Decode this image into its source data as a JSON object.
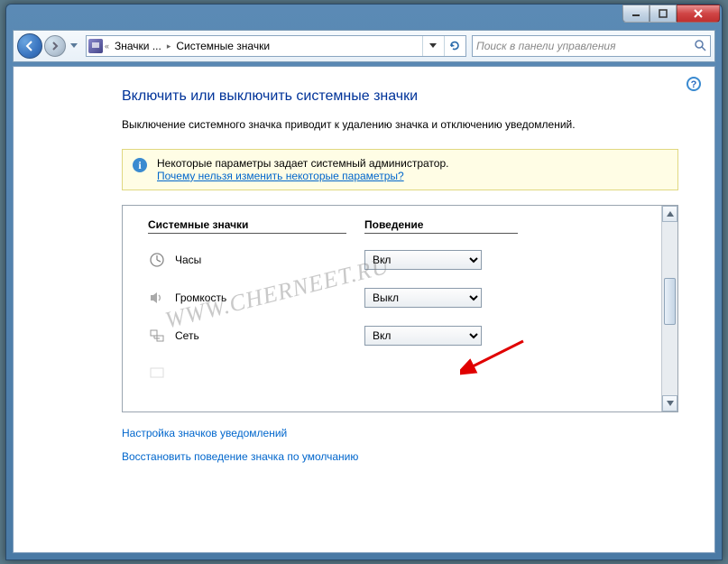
{
  "breadcrumb": {
    "level1": "Значки ...",
    "level2": "Системные значки"
  },
  "search": {
    "placeholder": "Поиск в панели управления"
  },
  "page": {
    "title": "Включить или выключить системные значки",
    "description": "Выключение системного значка приводит к удалению значка и отключению уведомлений."
  },
  "infobar": {
    "text": "Некоторые параметры задает системный администратор.",
    "link": "Почему нельзя изменить некоторые параметры?"
  },
  "columns": {
    "c1": "Системные значки",
    "c2": "Поведение"
  },
  "options": {
    "on": "Вкл",
    "off": "Выкл"
  },
  "rows": [
    {
      "label": "Часы",
      "value": "Вкл",
      "icon": "clock"
    },
    {
      "label": "Громкость",
      "value": "Выкл",
      "icon": "volume"
    },
    {
      "label": "Сеть",
      "value": "Вкл",
      "icon": "network"
    }
  ],
  "links": {
    "customize": "Настройка значков уведомлений",
    "restore": "Восстановить поведение значка по умолчанию"
  },
  "watermark": "WWW.CHERNEET.RU"
}
